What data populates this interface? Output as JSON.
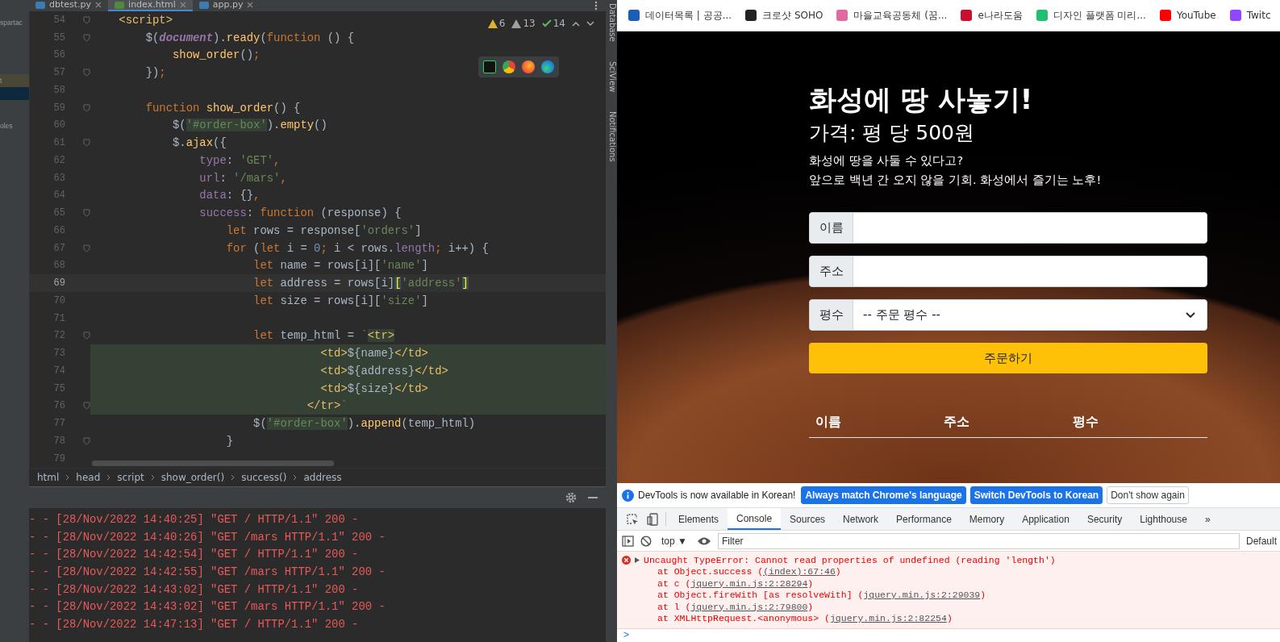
{
  "ide": {
    "tabs": [
      {
        "label": "dbtest.py",
        "selected": false
      },
      {
        "label": "index.html",
        "selected": true
      },
      {
        "label": "app.py",
        "selected": false
      }
    ],
    "project_panel": [
      {
        "label": "spartac",
        "selected": false
      },
      {
        "label": "t",
        "selected": false
      },
      {
        "selected": true
      },
      {
        "label": "oles",
        "selected": false
      }
    ],
    "inspections": [
      {
        "kind": "warning",
        "count": "6"
      },
      {
        "kind": "weak",
        "count": "13"
      },
      {
        "kind": "ok",
        "count": "14"
      }
    ],
    "code_lines": [
      {
        "number": "54",
        "fold": true,
        "current": false,
        "highlighted": false,
        "tokens": [
          {
            "kind": "tag",
            "t": "    <script>"
          }
        ]
      },
      {
        "number": "55",
        "fold": true,
        "current": false,
        "highlighted": false,
        "tokens": [
          {
            "kind": "p",
            "t": "        $("
          },
          {
            "kind": "it",
            "t": "document"
          },
          {
            "kind": "p",
            "t": ")."
          },
          {
            "kind": "fn",
            "t": "ready"
          },
          {
            "kind": "p",
            "t": "("
          },
          {
            "kind": "kw",
            "t": "function"
          },
          {
            "kind": "p",
            "t": " () {"
          }
        ]
      },
      {
        "number": "56",
        "fold": false,
        "current": false,
        "highlighted": false,
        "tokens": [
          {
            "kind": "fn",
            "t": "            show_order"
          },
          {
            "kind": "p",
            "t": "()"
          },
          {
            "kind": "kw",
            "t": ";"
          }
        ]
      },
      {
        "number": "57",
        "fold": true,
        "current": false,
        "highlighted": false,
        "tokens": [
          {
            "kind": "p",
            "t": "        })"
          },
          {
            "kind": "kw",
            "t": ";"
          }
        ]
      },
      {
        "number": "58",
        "fold": false,
        "current": false,
        "highlighted": false
      },
      {
        "number": "59",
        "fold": true,
        "current": false,
        "highlighted": false,
        "tokens": [
          {
            "kind": "kw",
            "t": "        function "
          },
          {
            "kind": "fn",
            "t": "show_order"
          },
          {
            "kind": "p",
            "t": "() {"
          }
        ]
      },
      {
        "number": "60",
        "fold": false,
        "current": false,
        "highlighted": false,
        "tokens": [
          {
            "kind": "p",
            "t": "            $("
          },
          {
            "kind": "strhl",
            "t": "'#order-box'"
          },
          {
            "kind": "p",
            "t": ")."
          },
          {
            "kind": "fn",
            "t": "empty"
          },
          {
            "kind": "p",
            "t": "()"
          }
        ]
      },
      {
        "number": "61",
        "fold": true,
        "current": false,
        "highlighted": false,
        "tokens": [
          {
            "kind": "p",
            "t": "            $."
          },
          {
            "kind": "fn",
            "t": "ajax"
          },
          {
            "kind": "p",
            "t": "({"
          }
        ]
      },
      {
        "number": "62",
        "fold": false,
        "current": false,
        "highlighted": false,
        "tokens": [
          {
            "kind": "prop",
            "t": "                type"
          },
          {
            "kind": "p",
            "t": ": "
          },
          {
            "kind": "str",
            "t": "'GET'"
          },
          {
            "kind": "kw",
            "t": ","
          }
        ]
      },
      {
        "number": "63",
        "fold": false,
        "current": false,
        "highlighted": false,
        "tokens": [
          {
            "kind": "prop",
            "t": "                url"
          },
          {
            "kind": "p",
            "t": ": "
          },
          {
            "kind": "str",
            "t": "'/mars'"
          },
          {
            "kind": "kw",
            "t": ","
          }
        ]
      },
      {
        "number": "64",
        "fold": false,
        "current": false,
        "highlighted": false,
        "tokens": [
          {
            "kind": "prop",
            "t": "                data"
          },
          {
            "kind": "p",
            "t": ": {}"
          },
          {
            "kind": "kw",
            "t": ","
          }
        ]
      },
      {
        "number": "65",
        "fold": true,
        "current": false,
        "highlighted": false,
        "tokens": [
          {
            "kind": "prop",
            "t": "                success"
          },
          {
            "kind": "p",
            "t": ": "
          },
          {
            "kind": "kw",
            "t": "function "
          },
          {
            "kind": "p",
            "t": "(response) {"
          }
        ]
      },
      {
        "number": "66",
        "fold": false,
        "current": false,
        "highlighted": false,
        "tokens": [
          {
            "kind": "kw",
            "t": "                    let "
          },
          {
            "kind": "p",
            "t": "rows = response["
          },
          {
            "kind": "str",
            "t": "'orders'"
          },
          {
            "kind": "p",
            "t": "]"
          }
        ]
      },
      {
        "number": "67",
        "fold": true,
        "current": false,
        "highlighted": false,
        "tokens": [
          {
            "kind": "kw",
            "t": "                    for "
          },
          {
            "kind": "p",
            "t": "("
          },
          {
            "kind": "kw",
            "t": "let "
          },
          {
            "kind": "p",
            "t": "i = "
          },
          {
            "kind": "num",
            "t": "0"
          },
          {
            "kind": "kw",
            "t": "; "
          },
          {
            "kind": "p",
            "t": "i < rows."
          },
          {
            "kind": "prop",
            "t": "length"
          },
          {
            "kind": "kw",
            "t": "; "
          },
          {
            "kind": "p",
            "t": "i++) {"
          }
        ]
      },
      {
        "number": "68",
        "fold": false,
        "current": false,
        "highlighted": false,
        "tokens": [
          {
            "kind": "kw",
            "t": "                        let "
          },
          {
            "kind": "p",
            "t": "name = rows[i]["
          },
          {
            "kind": "str",
            "t": "'name'"
          },
          {
            "kind": "p",
            "t": "]"
          }
        ]
      },
      {
        "number": "69",
        "fold": false,
        "current": true,
        "highlighted": false,
        "tokens": [
          {
            "kind": "kw",
            "t": "                        let "
          },
          {
            "kind": "p",
            "t": "address = rows[i]"
          },
          {
            "kind": "brk",
            "t": "["
          },
          {
            "kind": "str",
            "t": "'address'"
          },
          {
            "kind": "brk",
            "t": "]"
          }
        ]
      },
      {
        "number": "70",
        "fold": false,
        "current": false,
        "highlighted": false,
        "tokens": [
          {
            "kind": "kw",
            "t": "                        let "
          },
          {
            "kind": "p",
            "t": "size = rows[i]["
          },
          {
            "kind": "str",
            "t": "'size'"
          },
          {
            "kind": "p",
            "t": "]"
          }
        ]
      },
      {
        "number": "71",
        "fold": false,
        "current": false,
        "highlighted": false
      },
      {
        "number": "72",
        "fold": true,
        "current": false,
        "highlighted": false,
        "tokens": [
          {
            "kind": "kw",
            "t": "                        let "
          },
          {
            "kind": "p",
            "t": "temp_html = "
          },
          {
            "kind": "str",
            "t": "`"
          },
          {
            "kind": "taghl",
            "t": "<tr>"
          }
        ]
      },
      {
        "number": "73",
        "fold": false,
        "current": false,
        "highlighted": true,
        "tokens": [
          {
            "kind": "tag",
            "t": "                                  <td>"
          },
          {
            "kind": "p",
            "t": "${name}"
          },
          {
            "kind": "tag",
            "t": "</td>"
          }
        ]
      },
      {
        "number": "74",
        "fold": false,
        "current": false,
        "highlighted": true,
        "tokens": [
          {
            "kind": "tag",
            "t": "                                  <td>"
          },
          {
            "kind": "p",
            "t": "${address}"
          },
          {
            "kind": "tag",
            "t": "</td>"
          }
        ]
      },
      {
        "number": "75",
        "fold": false,
        "current": false,
        "highlighted": true,
        "tokens": [
          {
            "kind": "tag",
            "t": "                                  <td>"
          },
          {
            "kind": "p",
            "t": "${size}"
          },
          {
            "kind": "tag",
            "t": "</td>"
          }
        ]
      },
      {
        "number": "76",
        "fold": true,
        "current": false,
        "highlighted": true,
        "tokens": [
          {
            "kind": "tag",
            "t": "                                </tr>"
          },
          {
            "kind": "str",
            "t": "`"
          }
        ]
      },
      {
        "number": "77",
        "fold": false,
        "current": false,
        "highlighted": false,
        "tokens": [
          {
            "kind": "p",
            "t": "                        $("
          },
          {
            "kind": "strhl",
            "t": "'#order-box'"
          },
          {
            "kind": "p",
            "t": ")."
          },
          {
            "kind": "fn",
            "t": "append"
          },
          {
            "kind": "p",
            "t": "(temp_html)"
          }
        ]
      },
      {
        "number": "78",
        "fold": true,
        "current": false,
        "highlighted": false,
        "tokens": [
          {
            "kind": "p",
            "t": "                    }"
          }
        ]
      },
      {
        "number": "79",
        "fold": false,
        "current": false,
        "highlighted": false
      }
    ],
    "breadcrumbs": [
      "html",
      "head",
      "script",
      "show_order()",
      "success()",
      "address"
    ],
    "side_tools": [
      "Database",
      "SciView",
      "Notifications"
    ],
    "log_lines": [
      "- - [28/Nov/2022 14:40:25] \"GET / HTTP/1.1\" 200 -",
      "- - [28/Nov/2022 14:40:26] \"GET /mars HTTP/1.1\" 200 -",
      "- - [28/Nov/2022 14:42:54] \"GET / HTTP/1.1\" 200 -",
      "- - [28/Nov/2022 14:42:55] \"GET /mars HTTP/1.1\" 200 -",
      "- - [28/Nov/2022 14:43:02] \"GET / HTTP/1.1\" 200 -",
      "- - [28/Nov/2022 14:43:02] \"GET /mars HTTP/1.1\" 200 -",
      "- - [28/Nov/2022 14:47:13] \"GET / HTTP/1.1\" 200 -"
    ]
  },
  "browser": {
    "bookmarks": [
      {
        "label": "데이터목록 | 공공...",
        "color": "#1a5fb4"
      },
      {
        "label": "크로샷 SOHO",
        "color": "#222222"
      },
      {
        "label": "마을교육공동체 (꿈...",
        "color": "#e06aa0"
      },
      {
        "label": "e나라도움",
        "color": "#c8102e"
      },
      {
        "label": "디자인 플랫폼 미리...",
        "color": "#20c070"
      },
      {
        "label": "YouTube",
        "color": "#ff0000"
      },
      {
        "label": "Twitc",
        "color": "#9146ff"
      }
    ],
    "page": {
      "title": "화성에 땅 사놓기!",
      "price": "가격: 평 당 500원",
      "description": [
        "화성에 땅을 사둘 수 있다고?",
        "앞으로 백년 간 오지 않을 기회. 화성에서 즐기는 노후!"
      ],
      "fields": [
        {
          "kind": "text",
          "label": "이름"
        },
        {
          "kind": "text",
          "label": "주소"
        },
        {
          "kind": "select",
          "label": "평수",
          "placeholder": "-- 주문 평수 --"
        }
      ],
      "order_button": "주문하기",
      "table": {
        "columns": [
          "이름",
          "주소",
          "평수"
        ]
      }
    }
  },
  "devtools": {
    "banner": {
      "message": "DevTools is now available in Korean!",
      "buttons": [
        {
          "label": "Always match Chrome's language",
          "kind": "primary"
        },
        {
          "label": "Switch DevTools to Korean",
          "kind": "primary"
        },
        {
          "label": "Don't show again",
          "kind": "plain"
        }
      ]
    },
    "tabs": [
      {
        "label": "Elements",
        "selected": false
      },
      {
        "label": "Console",
        "selected": true
      },
      {
        "label": "Sources",
        "selected": false
      },
      {
        "label": "Network",
        "selected": false
      },
      {
        "label": "Performance",
        "selected": false
      },
      {
        "label": "Memory",
        "selected": false
      },
      {
        "label": "Application",
        "selected": false
      },
      {
        "label": "Security",
        "selected": false
      },
      {
        "label": "Lighthouse",
        "selected": false
      }
    ],
    "more_tabs": "»",
    "context": "top ▼",
    "filter_placeholder": "Filter",
    "levels": "Default",
    "error": {
      "message": "Uncaught TypeError: Cannot read properties of undefined (reading 'length')",
      "stack": [
        {
          "text": "at Object.success (",
          "link": "(index):67:46",
          "end": ")"
        },
        {
          "text": "at c (",
          "link": "jquery.min.js:2:28294",
          "end": ")"
        },
        {
          "text": "at Object.fireWith [as resolveWith] (",
          "link": "jquery.min.js:2:29039",
          "end": ")"
        },
        {
          "text": "at l (",
          "link": "jquery.min.js:2:79800",
          "end": ")"
        },
        {
          "text": "at XMLHttpRequest.<anonymous> (",
          "link": "jquery.min.js:2:82254",
          "end": ")"
        }
      ]
    },
    "prompt": ">"
  }
}
